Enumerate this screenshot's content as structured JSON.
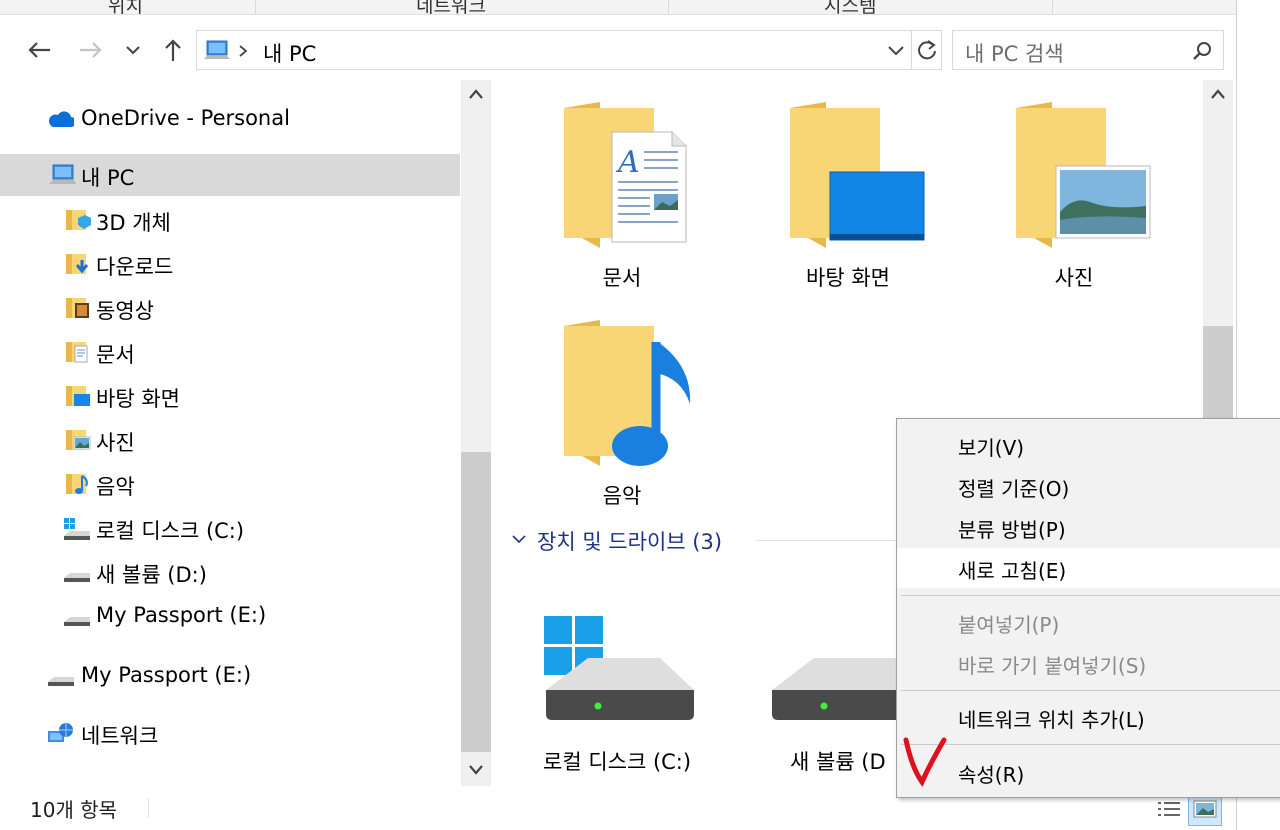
{
  "ribbon": {
    "tabs": [
      "위치",
      "네트워크",
      "시스템"
    ]
  },
  "address": {
    "path": "내 PC",
    "search_placeholder": "내 PC 검색"
  },
  "sidebar": {
    "items": [
      {
        "label": "OneDrive - Personal"
      },
      {
        "label": "내 PC"
      },
      {
        "label": "3D 개체"
      },
      {
        "label": "다운로드"
      },
      {
        "label": "동영상"
      },
      {
        "label": "문서"
      },
      {
        "label": "바탕 화면"
      },
      {
        "label": "사진"
      },
      {
        "label": "음악"
      },
      {
        "label": "로컬 디스크 (C:)"
      },
      {
        "label": "새 볼륨 (D:)"
      },
      {
        "label": "My Passport (E:)"
      },
      {
        "label": "My Passport (E:)"
      },
      {
        "label": "네트워크"
      }
    ]
  },
  "folders": [
    {
      "name": "문서"
    },
    {
      "name": "바탕 화면"
    },
    {
      "name": "사진"
    },
    {
      "name": "음악"
    }
  ],
  "devices": {
    "header": "장치 및 드라이브 (3)",
    "items": [
      {
        "name": "로컬 디스크 (C:)"
      },
      {
        "name": "새 볼륨 (D"
      }
    ]
  },
  "status": {
    "count": "10개 항목"
  },
  "context_menu": {
    "items": [
      {
        "label": "보기(V)"
      },
      {
        "label": "정렬 기준(O)"
      },
      {
        "label": "분류 방법(P)"
      },
      {
        "label": "새로 고침(E)"
      },
      {
        "label": "붙여넣기(P)"
      },
      {
        "label": "바로 가기 붙여넣기(S)"
      },
      {
        "label": "네트워크 위치 추가(L)"
      },
      {
        "label": "속성(R)"
      }
    ]
  },
  "colors": {
    "folder": "#f8d675",
    "folder_dark": "#e8b84a",
    "accent": "#0078d7",
    "annotation": "#e0101e"
  }
}
